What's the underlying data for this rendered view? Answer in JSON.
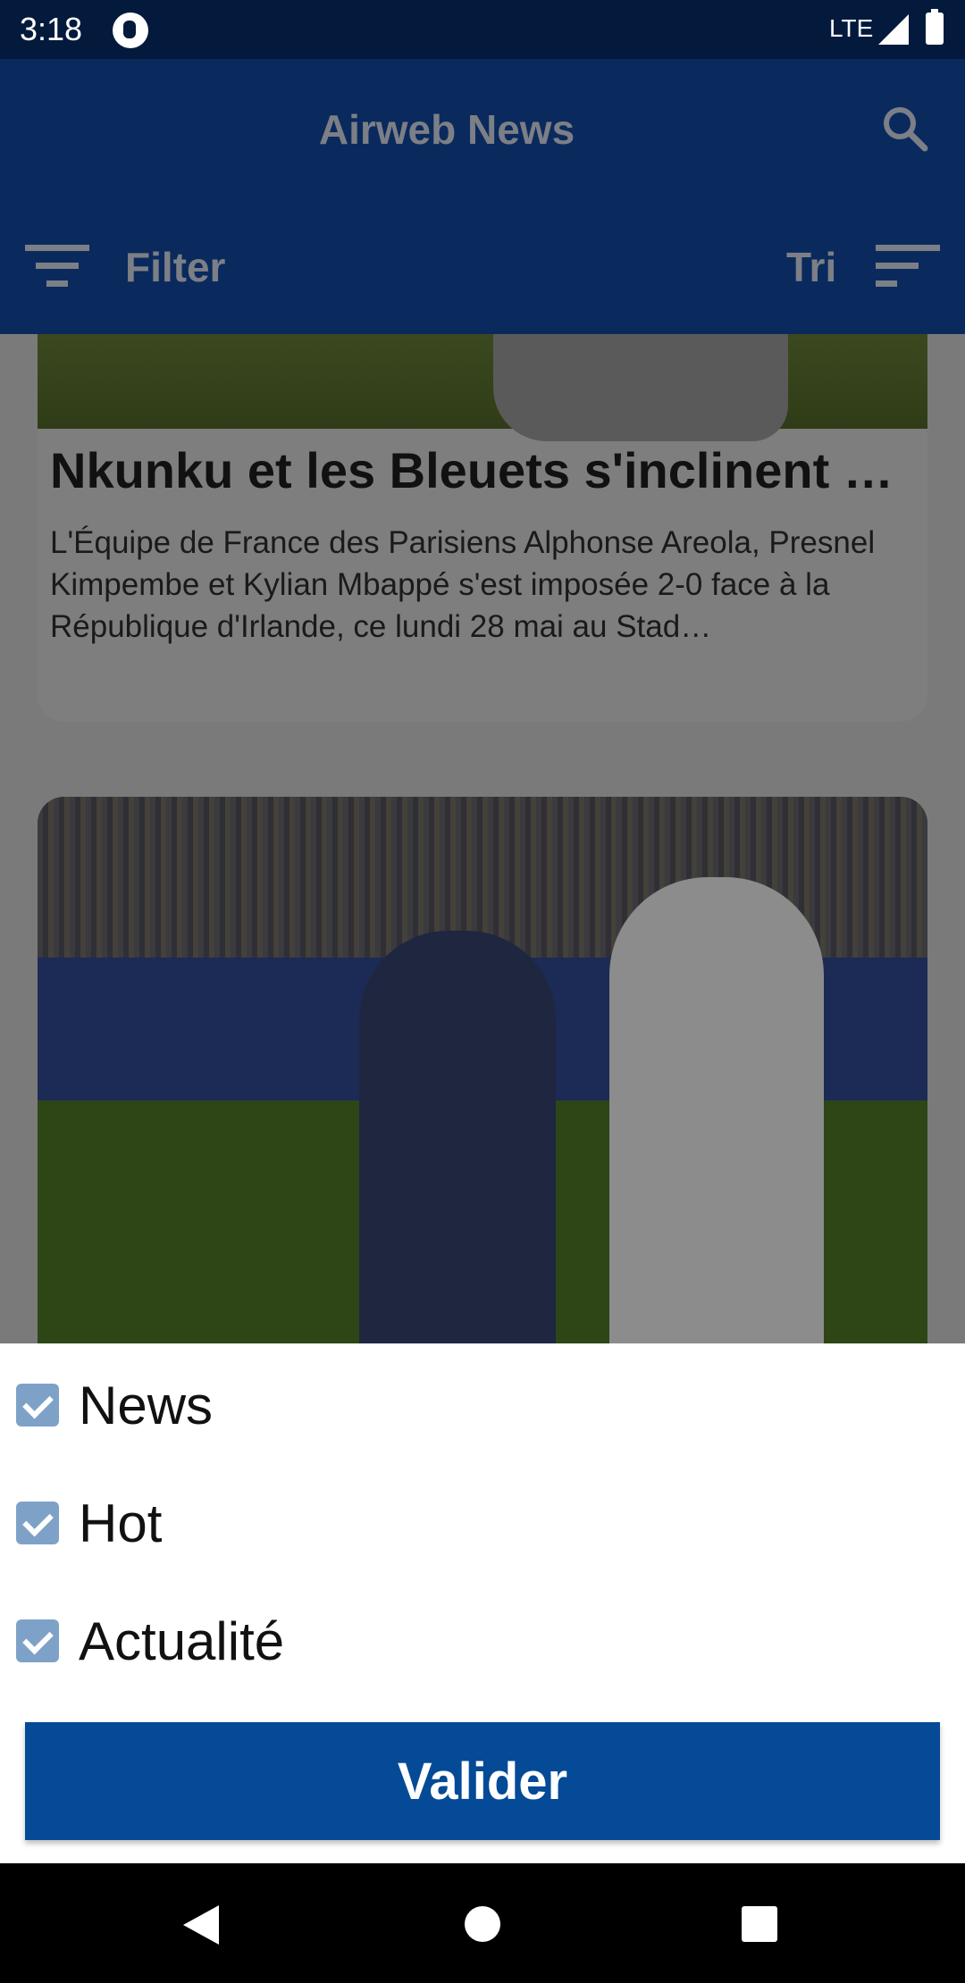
{
  "status_bar": {
    "time": "3:18",
    "network": "LTE"
  },
  "app_bar": {
    "title": "Airweb News",
    "filter_label": "Filter",
    "sort_label": "Tri"
  },
  "articles": [
    {
      "headline": "Nkunku et les Bleuets s'inclinent …",
      "summary": "L'Équipe de France des Parisiens Alphonse Areola, Presnel Kimpembe et Kylian Mbappé s'est imposée 2-0 face à la République d'Irlande, ce lundi 28 mai au Stad…"
    }
  ],
  "filter_sheet": {
    "options": [
      {
        "label": "News",
        "checked": true
      },
      {
        "label": "Hot",
        "checked": true
      },
      {
        "label": "Actualité",
        "checked": true
      }
    ],
    "confirm_label": "Valider"
  },
  "colors": {
    "app_bar": "#0a2a5e",
    "status_bar": "#031a3d",
    "button": "#054a96",
    "checkbox": "#7ea2c7"
  }
}
